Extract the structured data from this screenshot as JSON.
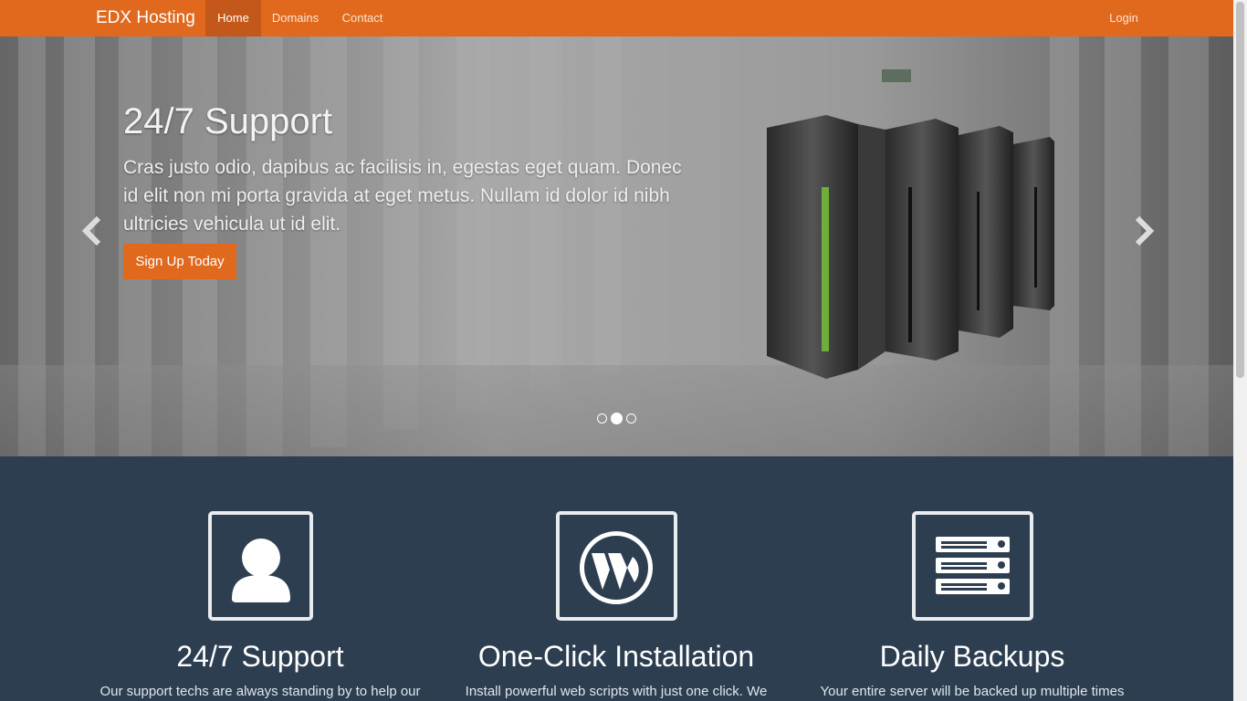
{
  "navbar": {
    "brand": "EDX Hosting",
    "items": [
      "Home",
      "Domains",
      "Contact"
    ],
    "active": "Home",
    "login": "Login",
    "color": "#e0691d"
  },
  "hero": {
    "title": "24/7 Support",
    "text": "Cras justo odio, dapibus ac facilisis in, egestas eget quam. Donec id elit non mi porta gravida at eget metus. Nullam id dolor id nibh ultricies vehicula ut id elit.",
    "button": "Sign Up Today",
    "prev_icon": "chevron-left-icon",
    "next_icon": "chevron-right-icon",
    "slide_count": 3,
    "active_slide": 2
  },
  "features": [
    {
      "icon": "user-icon",
      "title": "24/7 Support",
      "text": "Our support techs are always standing by to help our"
    },
    {
      "icon": "wordpress-icon",
      "title": "One-Click Installation",
      "text": "Install powerful web scripts with just one click. We"
    },
    {
      "icon": "server-icon",
      "title": "Daily Backups",
      "text": "Your entire server will be backed up multiple times"
    }
  ],
  "colors": {
    "accent": "#e0691d",
    "features_bg": "#2c3e50"
  }
}
